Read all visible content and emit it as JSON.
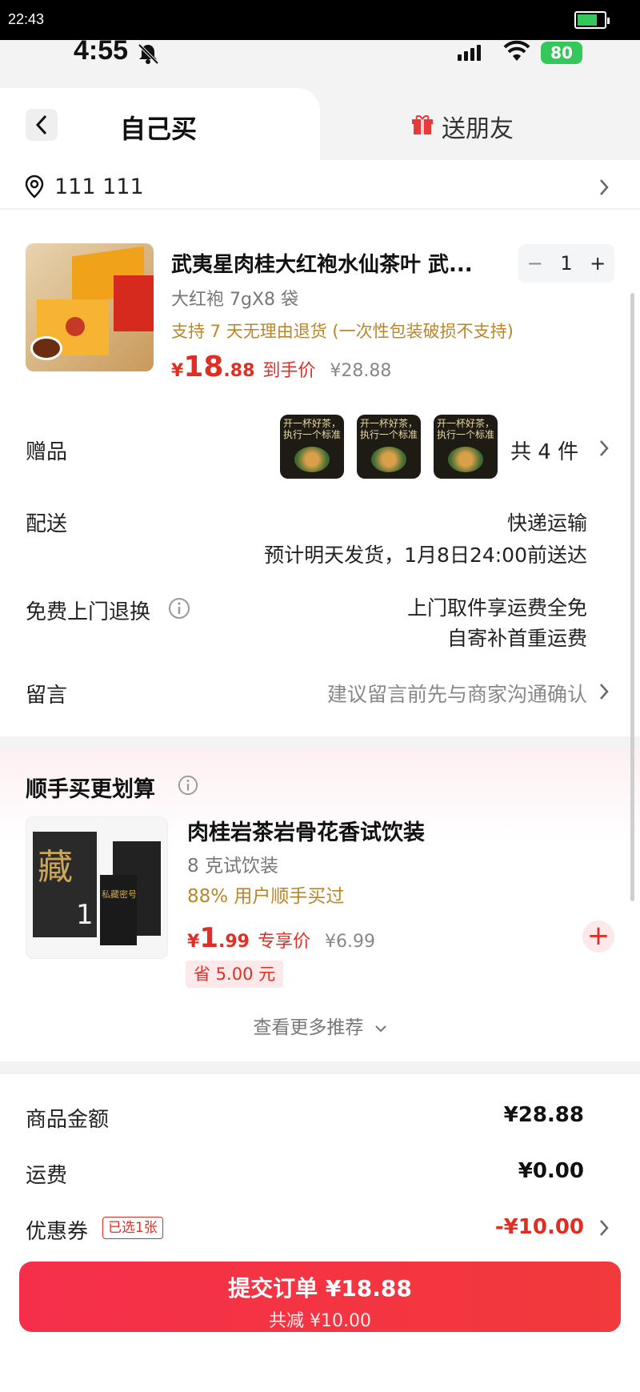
{
  "status_bar": {
    "time": "22:43"
  },
  "phone_status": {
    "time": "4:55",
    "battery": "80"
  },
  "tabs": {
    "self": "自己买",
    "friend": "送朋友"
  },
  "address": {
    "text": "111 111"
  },
  "product": {
    "title": "武夷星肉桂大红袍水仙茶叶 武...",
    "spec": "大红袍 7gX8 袋",
    "return_policy": "支持 7 天无理由退货 (一次性包装破损不支持)",
    "price_currency": "¥",
    "price_int": "18",
    "price_dec": ".88",
    "price_label": "到手价",
    "original_price": "¥28.88",
    "quantity": "1",
    "minus": "−",
    "plus": "+"
  },
  "gifts": {
    "label": "赠品",
    "count": "共 4 件",
    "gift_text": "开一杯好茶，执行一个标准"
  },
  "delivery": {
    "label": "配送",
    "method": "快递运输",
    "eta": "预计明天发货，1月8日24:00前送达"
  },
  "return_service": {
    "label": "免费上门退换",
    "line1": "上门取件享运费全免",
    "line2": "自寄补首重运费"
  },
  "message": {
    "label": "留言",
    "placeholder": "建议留言前先与商家沟通确认"
  },
  "recommend": {
    "title": "顺手买更划算",
    "item_title": "肉桂岩茶岩骨花香试饮装",
    "item_spec": "8 克试饮装",
    "bought": "88% 用户顺手买过",
    "price_currency": "¥",
    "price_int": "1",
    "price_dec": ".99",
    "price_label": "专享价",
    "original_price": "¥6.99",
    "save": "省 5.00 元",
    "more": "查看更多推荐",
    "pkg_char": "藏",
    "pkg_num": "1",
    "pkg_brand": "私藏密号"
  },
  "summary": {
    "goods_label": "商品金额",
    "goods_value": "¥28.88",
    "shipping_label": "运费",
    "shipping_value": "¥0.00",
    "coupon_label": "优惠券",
    "coupon_badge": "已选1张",
    "coupon_value": "-¥10.00"
  },
  "submit": {
    "main": "提交订单 ¥18.88",
    "sub": "共减 ¥10.00"
  },
  "colors": {
    "accent": "#e02e24",
    "gold": "#b8862b",
    "button": "#f2393b"
  }
}
